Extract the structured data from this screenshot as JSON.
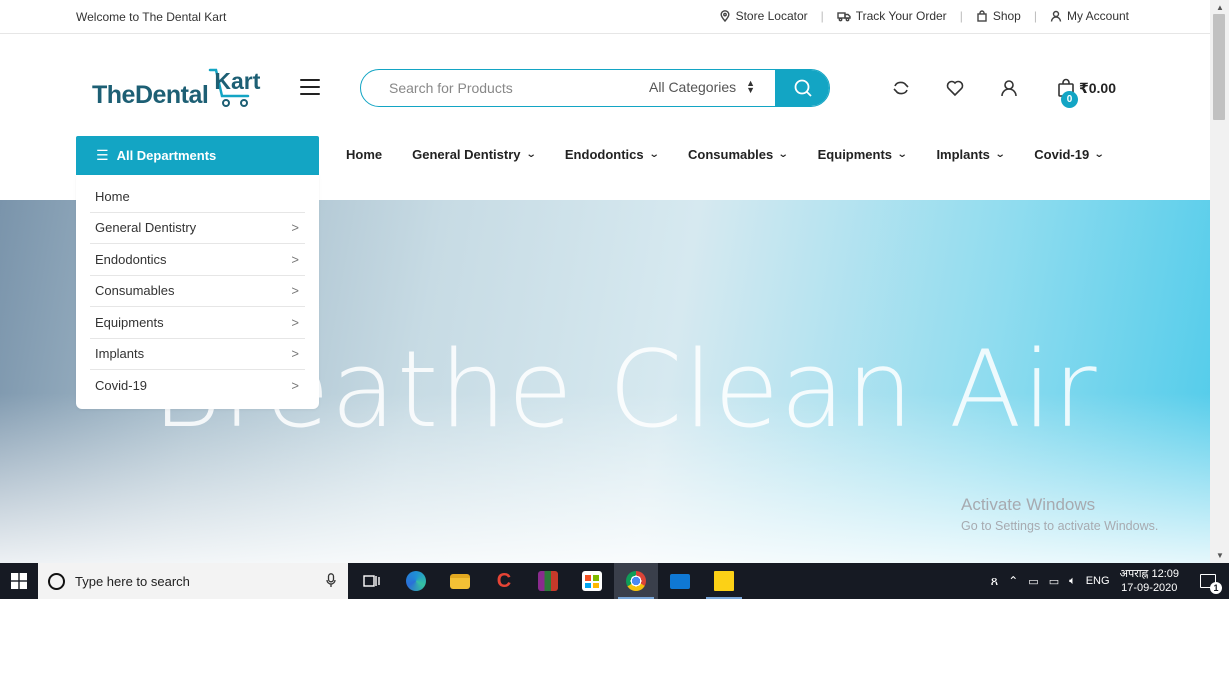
{
  "topbar": {
    "welcome": "Welcome to The Dental Kart",
    "links": [
      {
        "label": "Store Locator",
        "icon": "location-pin-icon"
      },
      {
        "label": "Track Your Order",
        "icon": "truck-icon"
      },
      {
        "label": "Shop",
        "icon": "shopping-bag-icon"
      },
      {
        "label": "My Account",
        "icon": "user-icon"
      }
    ]
  },
  "logo": {
    "text_a": "TheDental",
    "text_b": "Kart"
  },
  "search": {
    "placeholder": "Search for Products",
    "category": "All Categories"
  },
  "cart": {
    "count": "0",
    "amount": "₹0.00"
  },
  "departments": {
    "label": "All Departments",
    "items": [
      "Home",
      "General Dentistry",
      "Endodontics",
      "Consumables",
      "Equipments",
      "Implants",
      "Covid-19"
    ]
  },
  "nav": {
    "items": [
      "Home",
      "General Dentistry",
      "Endodontics",
      "Consumables",
      "Equipments",
      "Implants",
      "Covid-19"
    ]
  },
  "hero": {
    "title": "Breathe Clean Air"
  },
  "watermark": {
    "line1": "Activate Windows",
    "line2": "Go to Settings to activate Windows."
  },
  "taskbar": {
    "search_placeholder": "Type here to search",
    "lang": "ENG",
    "time": "अपराह्न 12:09",
    "date": "17-09-2020",
    "notifications": "1"
  },
  "colors": {
    "accent": "#13a5c4",
    "logo": "#1d5f74",
    "taskbar": "#161a23"
  }
}
